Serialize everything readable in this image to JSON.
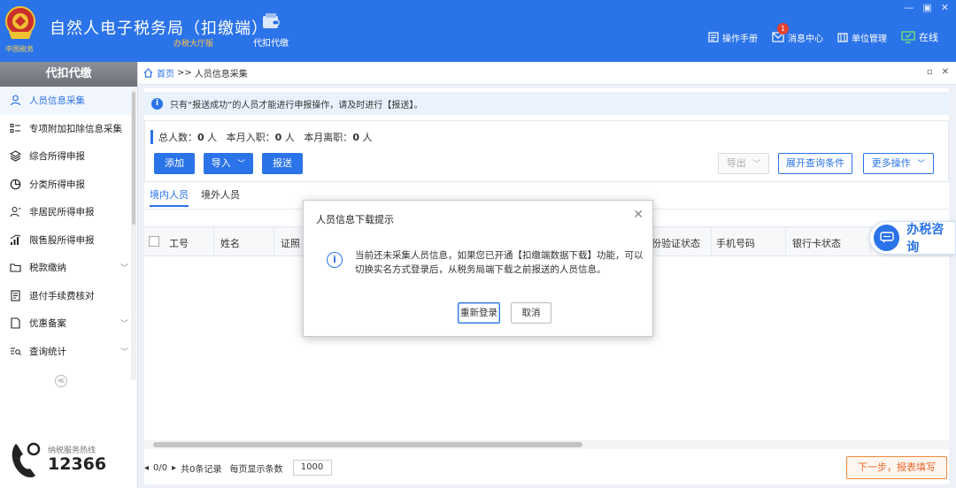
{
  "app": {
    "title": "自然人电子税务局（扣缴端）",
    "slogan": "办税大厅版",
    "logo_text": "中国税务",
    "module_label": "代扣代缴"
  },
  "header_actions": {
    "manual": "操作手册",
    "messages": "消息中心",
    "message_count": "1",
    "unit_mgmt": "单位管理",
    "online": "在线"
  },
  "sidebar": {
    "title": "代扣代缴",
    "items": [
      {
        "label": "人员信息采集",
        "icon": "person-icon",
        "active": true
      },
      {
        "label": "专项附加扣除信息采集",
        "icon": "list-icon"
      },
      {
        "label": "综合所得申报",
        "icon": "layers-icon"
      },
      {
        "label": "分类所得申报",
        "icon": "pie-icon"
      },
      {
        "label": "非居民所得申报",
        "icon": "user-outline-icon"
      },
      {
        "label": "限售股所得申报",
        "icon": "bar-signal-icon"
      },
      {
        "label": "税款缴纳",
        "icon": "folder-icon",
        "expandable": true
      },
      {
        "label": "退付手续费核对",
        "icon": "receipt-icon"
      },
      {
        "label": "优惠备案",
        "icon": "document-icon",
        "expandable": true
      },
      {
        "label": "查询统计",
        "icon": "search-list-icon",
        "expandable": true
      }
    ],
    "collapse": "≪",
    "hotline_label": "纳税服务热线",
    "hotline_number": "12366"
  },
  "breadcrumb": {
    "home": "首页",
    "separator": ">>",
    "current": "人员信息采集"
  },
  "notice": "只有“报送成功”的人员才能进行申报操作，请及时进行【报送】。",
  "stats": {
    "total_label": "总人数：",
    "total_value": "0",
    "unit1": "人",
    "joined_label": "本月入职：",
    "joined_value": "0",
    "unit2": "人",
    "left_label": "本月离职：",
    "left_value": "0",
    "unit3": "人"
  },
  "toolbar": {
    "add": "添加",
    "import": "导入",
    "submit": "报送",
    "export": "导出",
    "expand_query": "展开查询条件",
    "more_ops": "更多操作"
  },
  "tabs": [
    "境内人员",
    "境外人员"
  ],
  "table": {
    "columns": [
      "工号",
      "姓名",
      "证照",
      "身份验证状态",
      "手机号码",
      "银行卡状态"
    ]
  },
  "pager": {
    "records": "共0条记录",
    "page_info": "0/0",
    "per_page_label": "每页显示条数",
    "per_page_value": "1000"
  },
  "next_button": "下一步，报表填写",
  "consult": "办税咨询",
  "dialog": {
    "title": "人员信息下载提示",
    "message": "当前还未采集人员信息，如果您已开通【扣缴端数据下载】功能，可以切换实名方式登录后，从税务局端下载之前报送的人员信息。",
    "relogin": "重新登录",
    "cancel": "取消"
  },
  "colors": {
    "primary": "#2b73e8",
    "header_bg": "#2b73e8",
    "accent_orange": "#e8632a",
    "badge_red": "#e8412f"
  }
}
